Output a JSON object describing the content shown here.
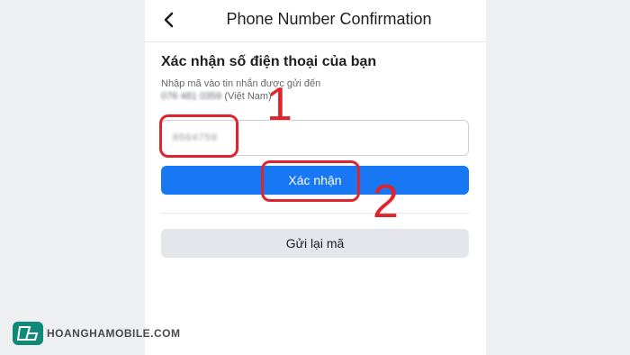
{
  "header": {
    "title": "Phone Number Confirmation",
    "back_icon": "chevron-left-icon"
  },
  "form": {
    "heading": "Xác nhận số điện thoại của bạn",
    "description_line1": "Nhập mã vào tin nhắn được gửi đến",
    "phone_masked": "076 481 0359",
    "country": "(Việt Nam)",
    "code_value": "8564759",
    "confirm_label": "Xác nhận",
    "resend_label": "Gửi lại mã"
  },
  "annotations": {
    "step1": "1",
    "step2": "2",
    "color": "#e0242d"
  },
  "colors": {
    "primary": "#1877f2",
    "secondary_button": "#e4e6eb",
    "background": "#eeeff1"
  },
  "watermark": {
    "text": "HOANGHAMOBILE.COM",
    "logo_icon": "hoangha-logo-icon"
  }
}
